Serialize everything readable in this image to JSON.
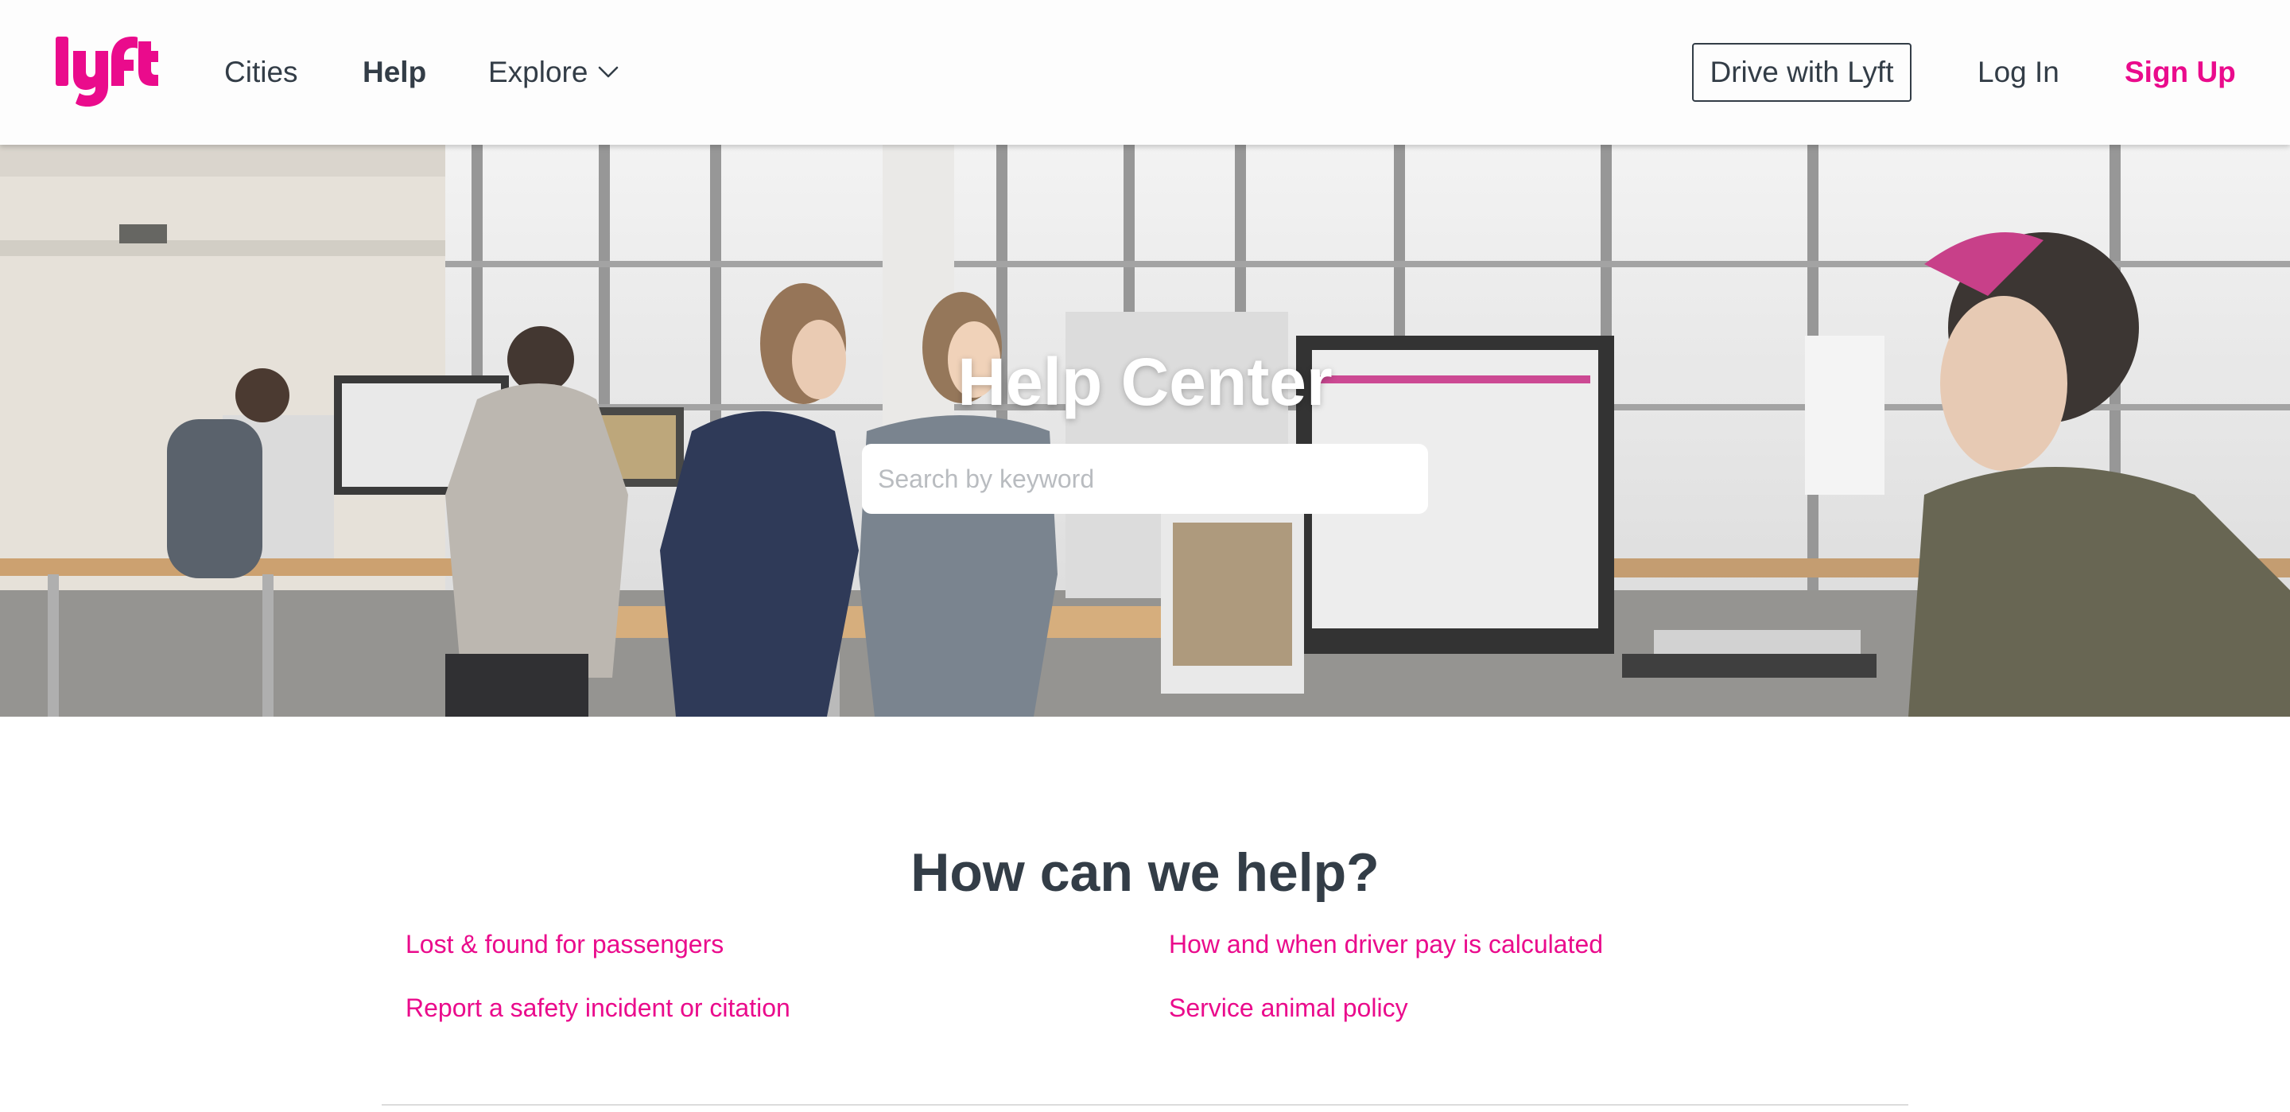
{
  "header": {
    "logo_alt": "lyft",
    "nav": {
      "cities": "Cities",
      "help": "Help",
      "explore": "Explore"
    },
    "drive_button": "Drive with Lyft",
    "login": "Log In",
    "signup": "Sign Up"
  },
  "hero": {
    "title": "Help Center",
    "search_placeholder": "Search by keyword",
    "search_value": ""
  },
  "help_section": {
    "heading": "How can we help?",
    "links": [
      "Lost & found for passengers",
      "How and when driver pay is calculated",
      "Report a safety incident or citation",
      "Service animal policy"
    ]
  },
  "colors": {
    "brand_pink": "#ea0b8c",
    "text_dark": "#333d47"
  }
}
